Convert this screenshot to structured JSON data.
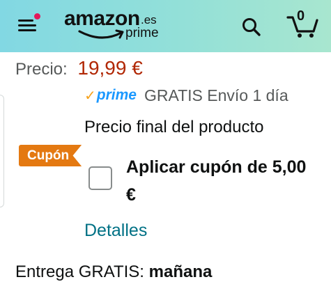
{
  "header": {
    "logo_wordmark": "amazon",
    "logo_tld": ".es",
    "logo_prime": "prime",
    "menu_icon": "hamburger-menu-icon",
    "search_icon": "search-icon",
    "cart_icon": "cart-icon",
    "cart_count": "0",
    "notification_dot_color": "#e3195a",
    "gradient_colors": [
      "#82d8e3",
      "#a8e6cf"
    ]
  },
  "price": {
    "label": "Precio:",
    "value": "19,99 €",
    "value_color": "#b12704"
  },
  "prime_shipping": {
    "check": "✓",
    "prime_word": "prime",
    "text": "GRATIS Envío 1 día"
  },
  "final_price_text": "Precio final del producto",
  "coupon": {
    "badge": "Cupón",
    "badge_color": "#e47911",
    "checkbox_checked": false,
    "label": "Aplicar cupón de 5,00 €",
    "details_link": "Detalles"
  },
  "delivery": {
    "prefix": "Entrega GRATIS:",
    "day": "mañana"
  }
}
